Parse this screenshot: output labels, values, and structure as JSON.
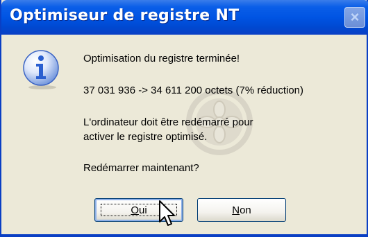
{
  "window": {
    "title": "Optimiseur de registre NT",
    "close_glyph": "×"
  },
  "message": {
    "line1": "Optimisation du registre terminée!",
    "line2": "37 031 936 -> 34 611 200 octets (7% réduction)",
    "line3a": "L'ordinateur doit être redémarré pour",
    "line3b": "activer le registre optimisé.",
    "line4": "Redémarrer maintenant?"
  },
  "buttons": {
    "yes": {
      "accel": "O",
      "rest": "ui"
    },
    "no": {
      "accel": "N",
      "rest": "on"
    }
  },
  "icons": {
    "info": "info-icon",
    "watermark": "watermark-logo",
    "cursor": "mouse-pointer"
  },
  "colors": {
    "titlebar": "#0054e3",
    "dialog_bg": "#ece9d8",
    "info_blue": "#2a5fd0"
  }
}
